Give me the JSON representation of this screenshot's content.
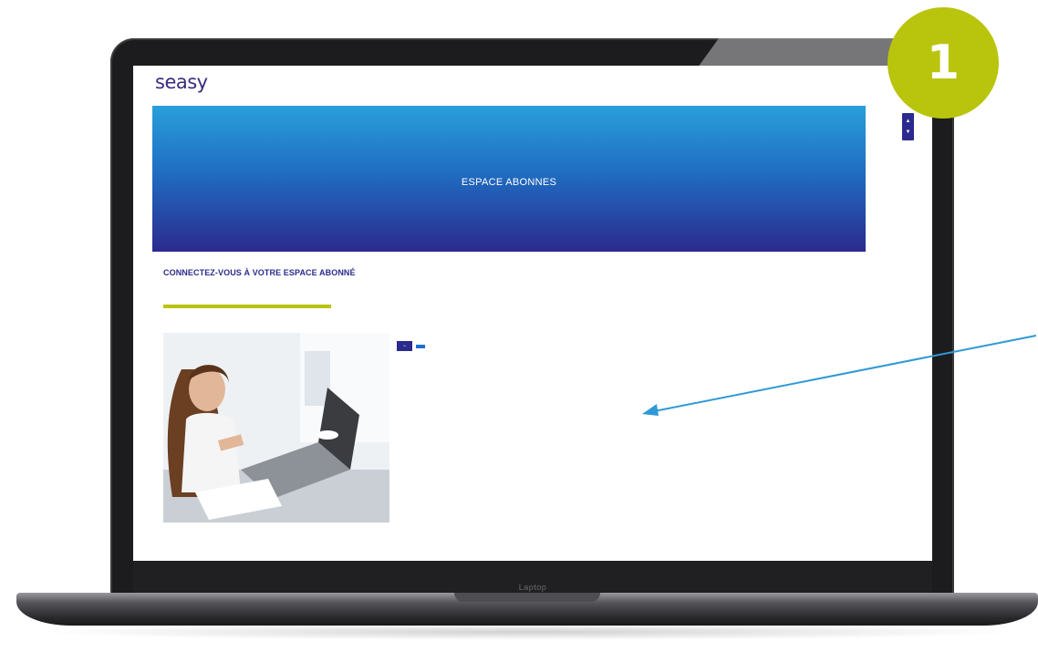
{
  "step": {
    "number": "1"
  },
  "laptop": {
    "chin_label": "Laptop"
  },
  "site": {
    "logo": {
      "wordmark": "seasy",
      "tagline": ""
    },
    "nav": {
      "items": [
        "",
        "",
        "",
        "",
        "",
        "",
        ""
      ]
    },
    "hero": {
      "title": "ESPACE ABONNES",
      "breadcrumb": ""
    },
    "widget": {
      "up": "▲",
      "down": "▼"
    },
    "section_title": "CONNECTEZ-VOUS À VOTRE ESPACE ABONNÉ",
    "connect": {
      "toggle": "−",
      "link_label": ""
    },
    "bullets": [
      "",
      "",
      "",
      "",
      ""
    ]
  },
  "colors": {
    "accent_lime": "#b9c40d",
    "brand_navy": "#2b2a8e",
    "hero_top": "#2a9fdb",
    "hero_bottom": "#2b2a8e",
    "arrow_blue": "#2f9ad6"
  }
}
